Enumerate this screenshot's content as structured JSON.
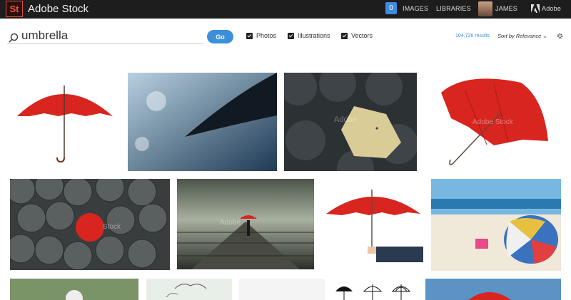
{
  "app": {
    "logo": "St",
    "name": "Adobe Stock"
  },
  "topnav": {
    "badge": "0",
    "images": "IMAGES",
    "libraries": "LIBRARIES",
    "user": "JAMES",
    "adobe": "Adobe"
  },
  "search": {
    "query": "umbrella",
    "go_label": "Go"
  },
  "filters": [
    {
      "label": "Photos",
      "checked": true
    },
    {
      "label": "Illustrations",
      "checked": true
    },
    {
      "label": "Vectors",
      "checked": true
    }
  ],
  "results_count": "104,726 results",
  "sort_label": "Sort by Relevance",
  "thumbnails": [
    {
      "watermark": ""
    },
    {
      "watermark": ""
    },
    {
      "watermark": "Adobe"
    },
    {
      "watermark": "Adobe Stock"
    },
    {
      "watermark": "Stock"
    },
    {
      "watermark": "Adobe"
    },
    {
      "watermark": ""
    },
    {
      "watermark": ""
    }
  ],
  "colors": {
    "accent": "#3c8fd9",
    "topbar": "#1d1d1d",
    "umbrella_red": "#d8251f"
  }
}
